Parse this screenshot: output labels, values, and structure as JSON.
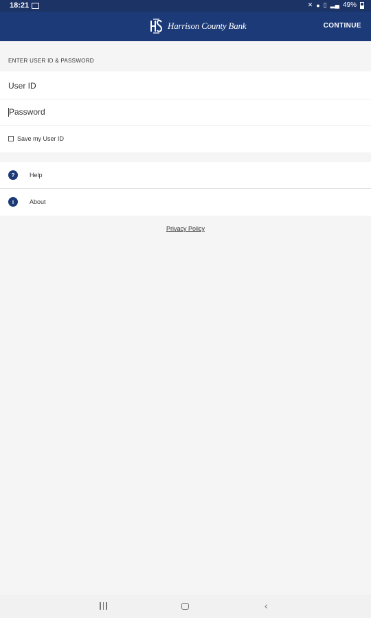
{
  "status_bar": {
    "time": "18:21",
    "battery_percent": "49%",
    "icons": [
      "gallery-icon",
      "mute-icon",
      "location-icon",
      "nfc-icon",
      "signal-icon",
      "battery-icon"
    ]
  },
  "app_bar": {
    "brand": "Harrison County Bank",
    "continue_label": "CONTINUE"
  },
  "login": {
    "section_title": "ENTER USER ID & PASSWORD",
    "user_id_placeholder": "User ID",
    "password_placeholder": "Password",
    "save_user_id_label": "Save my User ID",
    "save_user_id_checked": false
  },
  "menu": {
    "items": [
      {
        "label": "Help",
        "icon": "?"
      },
      {
        "label": "About",
        "icon": "i"
      }
    ]
  },
  "footer": {
    "privacy_label": "Privacy Policy"
  },
  "colors": {
    "brand_primary": "#1c3a78",
    "status_bar": "#1c3366",
    "background": "#f5f5f5"
  }
}
